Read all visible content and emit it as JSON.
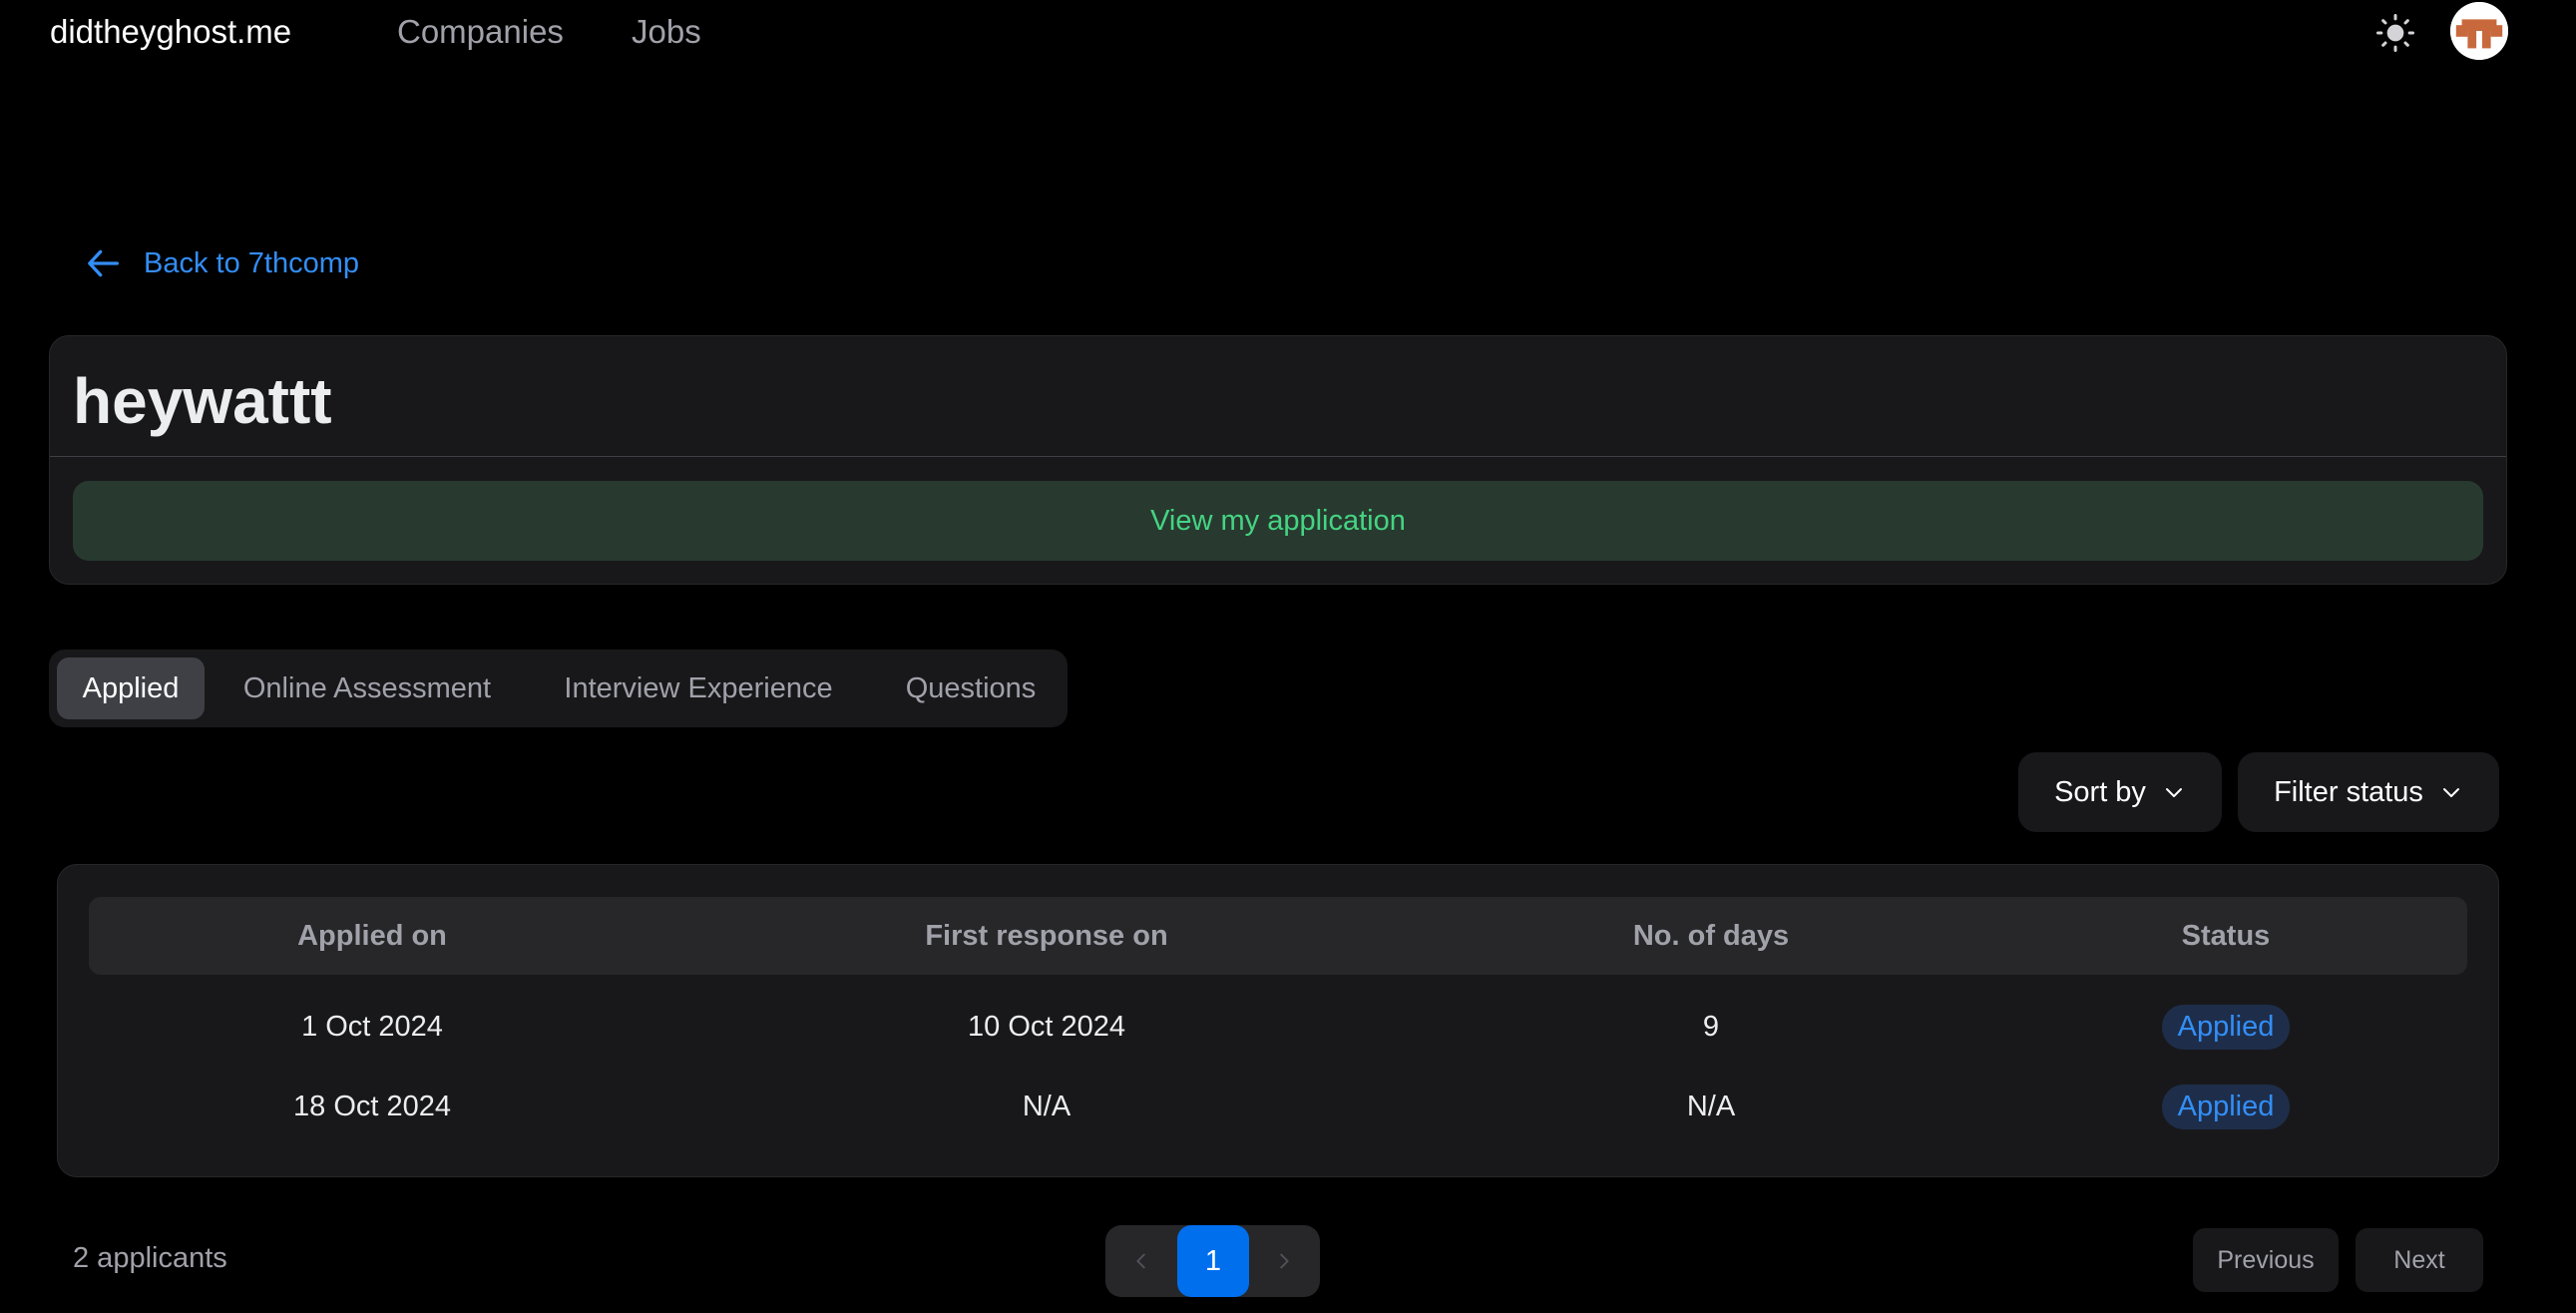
{
  "nav": {
    "brand": "didtheyghost.me",
    "links": [
      "Companies",
      "Jobs"
    ]
  },
  "back_link": "Back to 7thcomp",
  "job": {
    "title": "heywattt",
    "view_application": "View my application"
  },
  "tabs": [
    {
      "label": "Applied",
      "active": true
    },
    {
      "label": "Online Assessment",
      "active": false
    },
    {
      "label": "Interview Experience",
      "active": false
    },
    {
      "label": "Questions",
      "active": false
    }
  ],
  "controls": {
    "sort_label": "Sort by",
    "filter_label": "Filter status"
  },
  "table": {
    "headers": [
      "Applied on",
      "First response on",
      "No. of days",
      "Status"
    ],
    "rows": [
      {
        "applied_on": "1 Oct 2024",
        "first_response_on": "10 Oct 2024",
        "days": "9",
        "status": "Applied"
      },
      {
        "applied_on": "18 Oct 2024",
        "first_response_on": "N/A",
        "days": "N/A",
        "status": "Applied"
      }
    ]
  },
  "footer": {
    "count": "2 applicants",
    "current_page": "1",
    "previous": "Previous",
    "next": "Next"
  },
  "colors": {
    "accent_blue": "#338EF7",
    "success_green": "#45D483",
    "page_active": "#006FEE"
  },
  "icons": {
    "theme": "sun-icon",
    "back": "arrow-left-icon",
    "dropdown": "chevron-down-icon",
    "pager_prev": "chevron-left-icon",
    "pager_next": "chevron-right-icon"
  }
}
